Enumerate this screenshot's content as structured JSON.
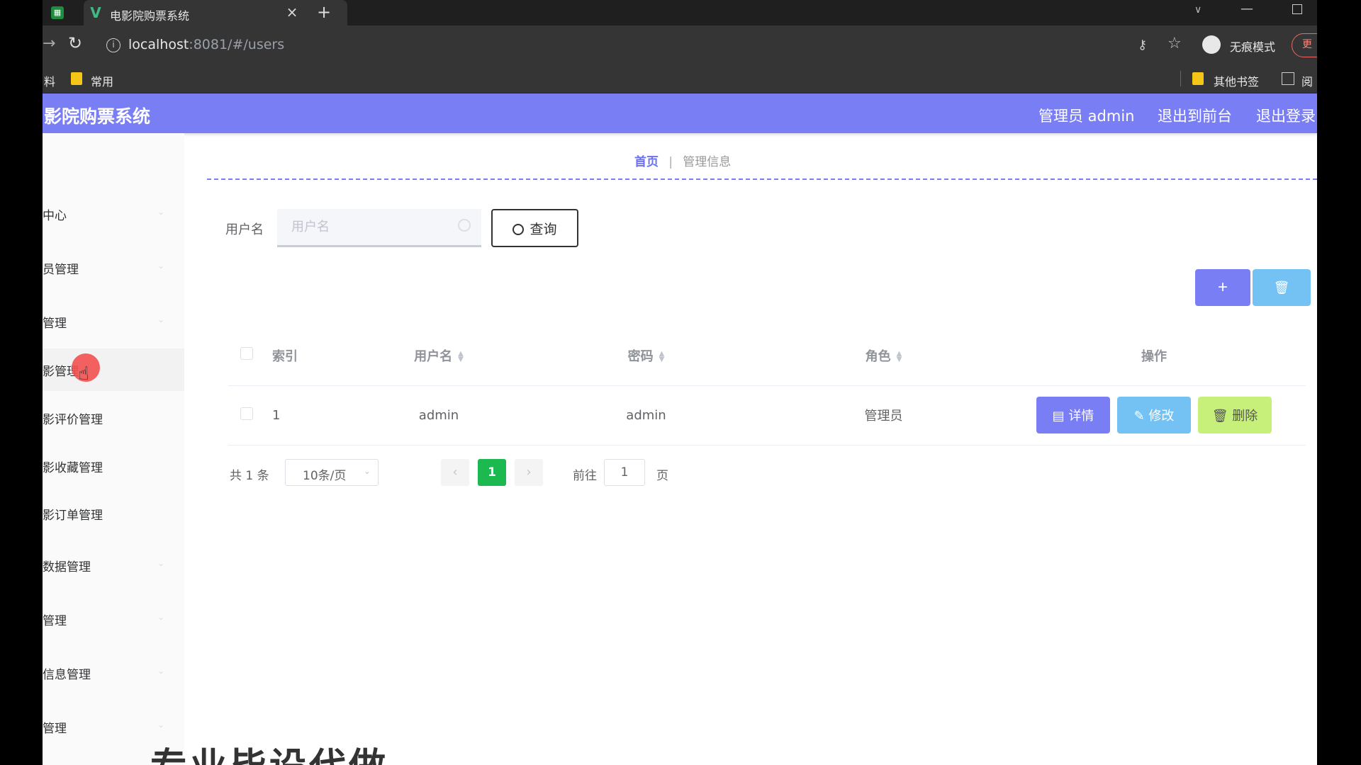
{
  "browser": {
    "tab_title": "电影院购票系统",
    "tab_close": "×",
    "new_tab": "+",
    "url_host": "localhost",
    "url_path": ":8081/#/users",
    "incognito_label": "无痕模式",
    "update_label": "更",
    "bookmarks": {
      "left_cut": "料",
      "common": "常用",
      "other": "其他书签",
      "reader": "阅"
    }
  },
  "header": {
    "title": "影院购票系统",
    "admin_label": "管理员 admin",
    "back_to_front": "退出到前台",
    "logout": "退出登录"
  },
  "sidebar": {
    "items": [
      {
        "label": "中心"
      },
      {
        "label": "员管理"
      },
      {
        "label": "管理"
      },
      {
        "label": "影管理"
      },
      {
        "label": "影评价管理"
      },
      {
        "label": "影收藏管理"
      },
      {
        "label": "影订单管理"
      },
      {
        "label": "数据管理"
      },
      {
        "label": "管理"
      },
      {
        "label": "信息管理"
      },
      {
        "label": "管理"
      }
    ]
  },
  "breadcrumb": {
    "home": "首页",
    "current": "管理信息"
  },
  "search": {
    "label": "用户名",
    "placeholder": "用户名",
    "query_button": "查询"
  },
  "actions": {
    "add": "+",
    "batch_delete": "🗑"
  },
  "table": {
    "headers": {
      "index": "索引",
      "username": "用户名",
      "password": "密码",
      "role": "角色",
      "ops": "操作"
    },
    "rows": [
      {
        "index": "1",
        "username": "admin",
        "password": "admin",
        "role": "管理员"
      }
    ],
    "op_labels": {
      "detail": "详情",
      "edit": "修改",
      "delete": "删除"
    }
  },
  "pagination": {
    "total": "共 1 条",
    "page_size": "10条/页",
    "current": "1",
    "goto": "前往",
    "goto_value": "1",
    "page_unit": "页"
  },
  "watermark": "专业毕设代做",
  "colors": {
    "primary": "#7a7ef5",
    "info": "#74c2f4",
    "success": "#1cb850",
    "warning": "#c6f07a"
  }
}
